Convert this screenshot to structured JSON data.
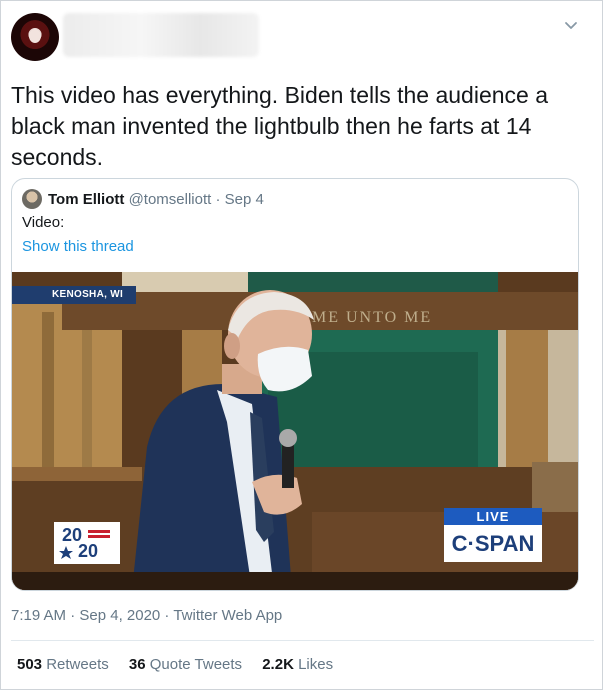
{
  "tweet": {
    "text": "This video has everything. Biden tells the audience a black man invented the lightbulb then he farts at 14 seconds.",
    "timestamp": "7:19 AM · Sep 4, 2020 · Twitter Web App"
  },
  "quoted_tweet": {
    "name": "Tom Elliott",
    "handle_date": "@tomselliott · Sep 4",
    "text": "Video:",
    "thread_link": "Show this thread"
  },
  "video": {
    "location": "KENOSHA, WI",
    "wall_text": "ME UNTO ME",
    "live_label": "LIVE",
    "network": "C·SPAN",
    "logo_top": "20",
    "logo_bottom": "20"
  },
  "stats": {
    "retweets_count": "503",
    "retweets_label": "Retweets",
    "quotes_count": "36",
    "quotes_label": "Quote Tweets",
    "likes_count": "2.2K",
    "likes_label": "Likes"
  },
  "icons": {
    "menu": "chevron-down-icon"
  }
}
